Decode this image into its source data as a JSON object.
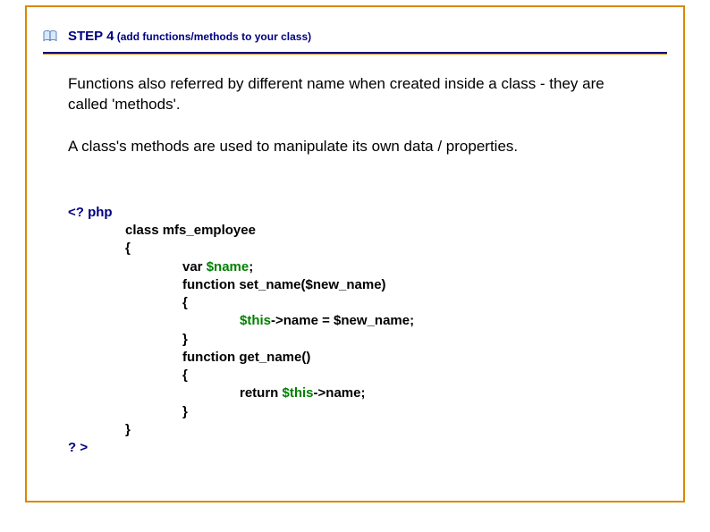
{
  "header": {
    "step_label": "STEP 4",
    "step_subtitle": " (add functions/methods to your class)"
  },
  "body": {
    "paragraph1": "Functions also referred by different name when created inside a class - they are called 'methods'.",
    "paragraph2": "A class's methods are used to manipulate its own data / properties."
  },
  "code": {
    "open_tag": "<? php",
    "class_decl": "class mfs_employee",
    "brace_open": "{",
    "var_decl_prefix": "var ",
    "var_decl_name": "$name",
    "var_decl_suffix": ";",
    "func1_sig": "function set_name($new_name)",
    "func1_open": "{",
    "this1": "$this",
    "func1_body_rest": "->name = $new_name;",
    "func1_close": "}",
    "func2_sig": "function get_name()",
    "func2_open": "{",
    "func2_return": "return ",
    "this2": "$this",
    "func2_body_rest": "->name;",
    "func2_close": "}",
    "class_close": "}",
    "close_tag": "? >"
  }
}
